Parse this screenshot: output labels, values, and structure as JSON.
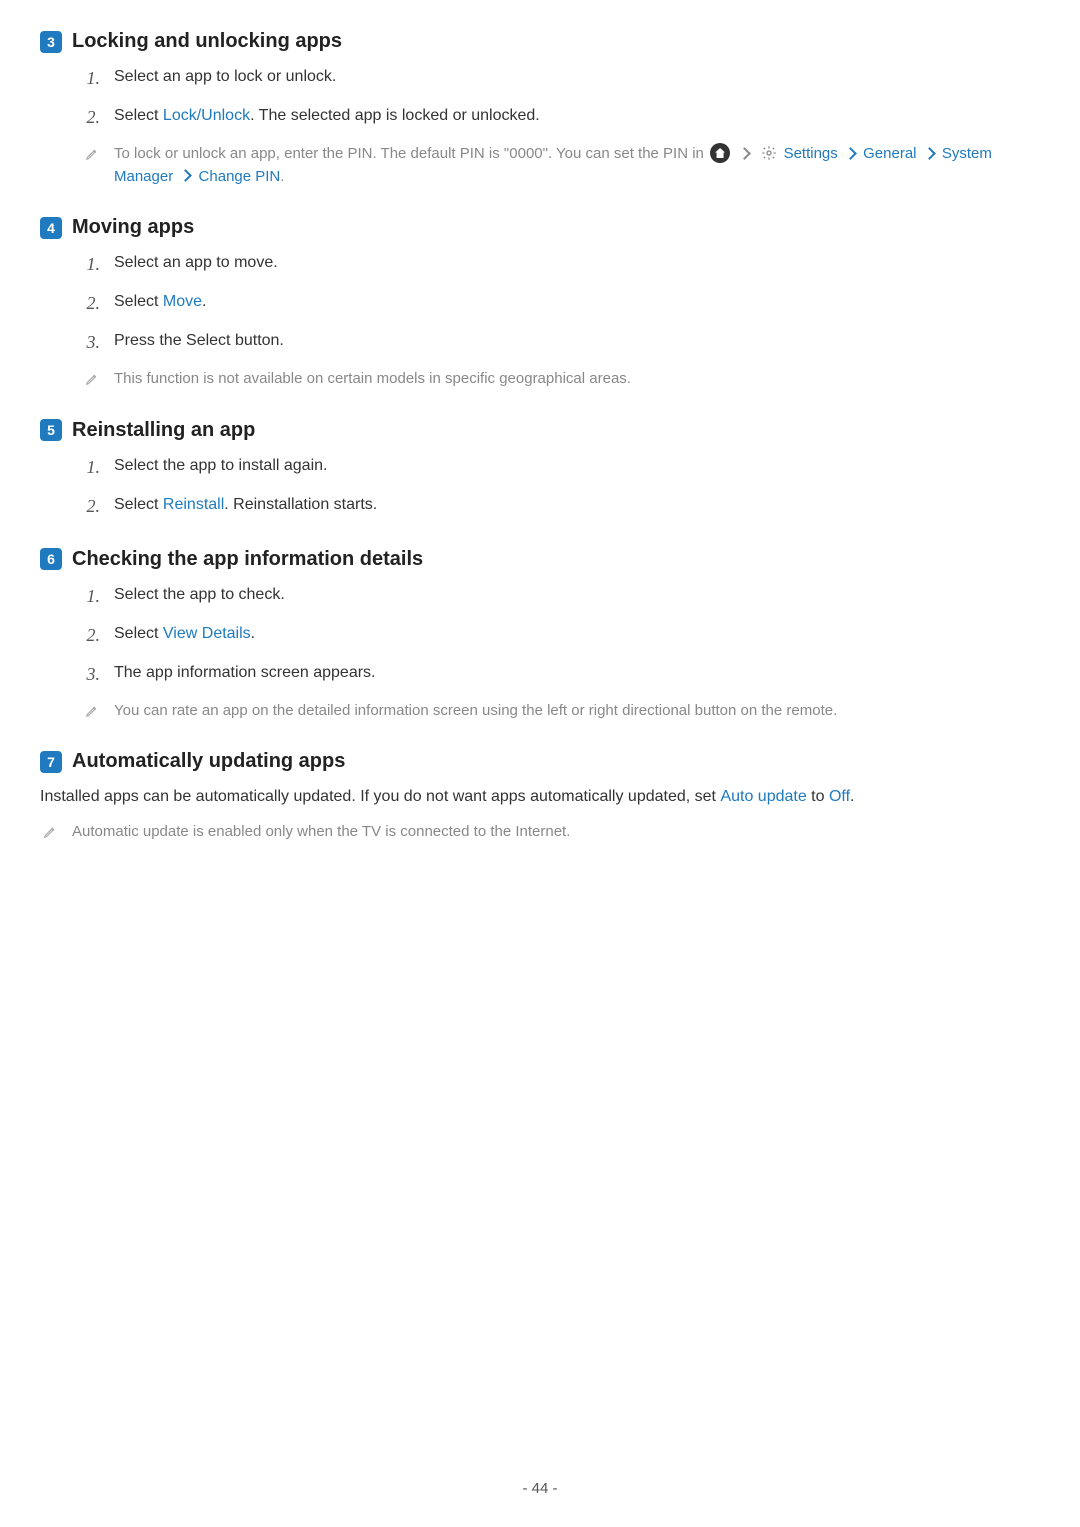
{
  "sections": {
    "s3": {
      "badge": "3",
      "title": "Locking and unlocking apps",
      "items": [
        {
          "num": "1.",
          "text_plain": "Select an app to lock or unlock."
        },
        {
          "num": "2.",
          "prefix": "Select ",
          "link": "Lock/Unlock",
          "suffix": ". The selected app is locked or unlocked."
        }
      ],
      "note": {
        "prefix": "To lock or unlock an app, enter the PIN. The default PIN is \"0000\". You can set the PIN in ",
        "settings_label": "Settings",
        "general_label": "General",
        "sysmgr_label": "System Manager",
        "changepin_label": "Change PIN",
        "period": "."
      }
    },
    "s4": {
      "badge": "4",
      "title": "Moving apps",
      "items": [
        {
          "num": "1.",
          "text_plain": "Select an app to move."
        },
        {
          "num": "2.",
          "prefix": "Select ",
          "link": "Move",
          "suffix": "."
        },
        {
          "num": "3.",
          "text_plain": "Press the Select button."
        }
      ],
      "note_plain": "This function is not available on certain models in specific geographical areas."
    },
    "s5": {
      "badge": "5",
      "title": "Reinstalling an app",
      "items": [
        {
          "num": "1.",
          "text_plain": "Select the app to install again."
        },
        {
          "num": "2.",
          "prefix": "Select ",
          "link": "Reinstall",
          "suffix": ". Reinstallation starts."
        }
      ]
    },
    "s6": {
      "badge": "6",
      "title": "Checking the app information details",
      "items": [
        {
          "num": "1.",
          "text_plain": "Select the app to check."
        },
        {
          "num": "2.",
          "prefix": "Select ",
          "link": "View Details",
          "suffix": "."
        },
        {
          "num": "3.",
          "text_plain": "The app information screen appears."
        }
      ],
      "note_plain": "You can rate an app on the detailed information screen using the left or right directional button on the remote."
    },
    "s7": {
      "badge": "7",
      "title": "Automatically updating apps",
      "paragraph": {
        "prefix": "Installed apps can be automatically updated. If you do not want apps automatically updated, set ",
        "link1": "Auto update",
        "mid": " to ",
        "link2": "Off",
        "suffix": "."
      },
      "note_plain": "Automatic update is enabled only when the TV is connected to the Internet."
    }
  },
  "page_number": "- 44 -"
}
